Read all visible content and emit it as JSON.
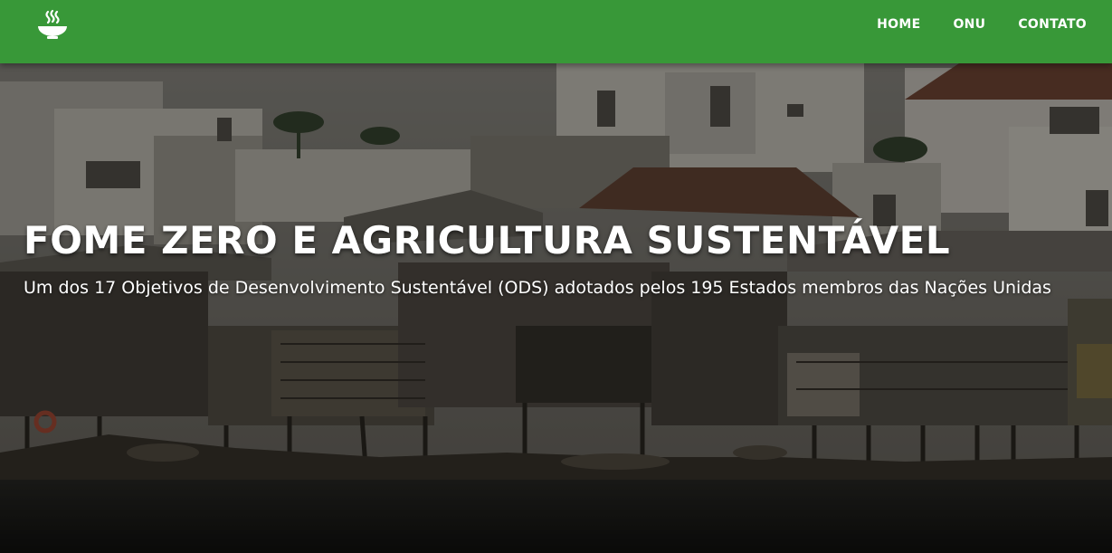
{
  "nav": {
    "logo_icon": "food-bowl-icon",
    "links": [
      {
        "label": "HOME"
      },
      {
        "label": "ONU"
      },
      {
        "label": "CONTATO"
      }
    ],
    "background_color": "#389838"
  },
  "hero": {
    "title": "FOME ZERO E AGRICULTURA SUSTENTÁVEL",
    "subtitle": "Um dos 17 Objetivos de Desenvolvimento Sustentável (ODS) adotados pelos 195 Estados membros das Nações Unidas",
    "background_image": "riverside-stilt-houses-photo"
  }
}
